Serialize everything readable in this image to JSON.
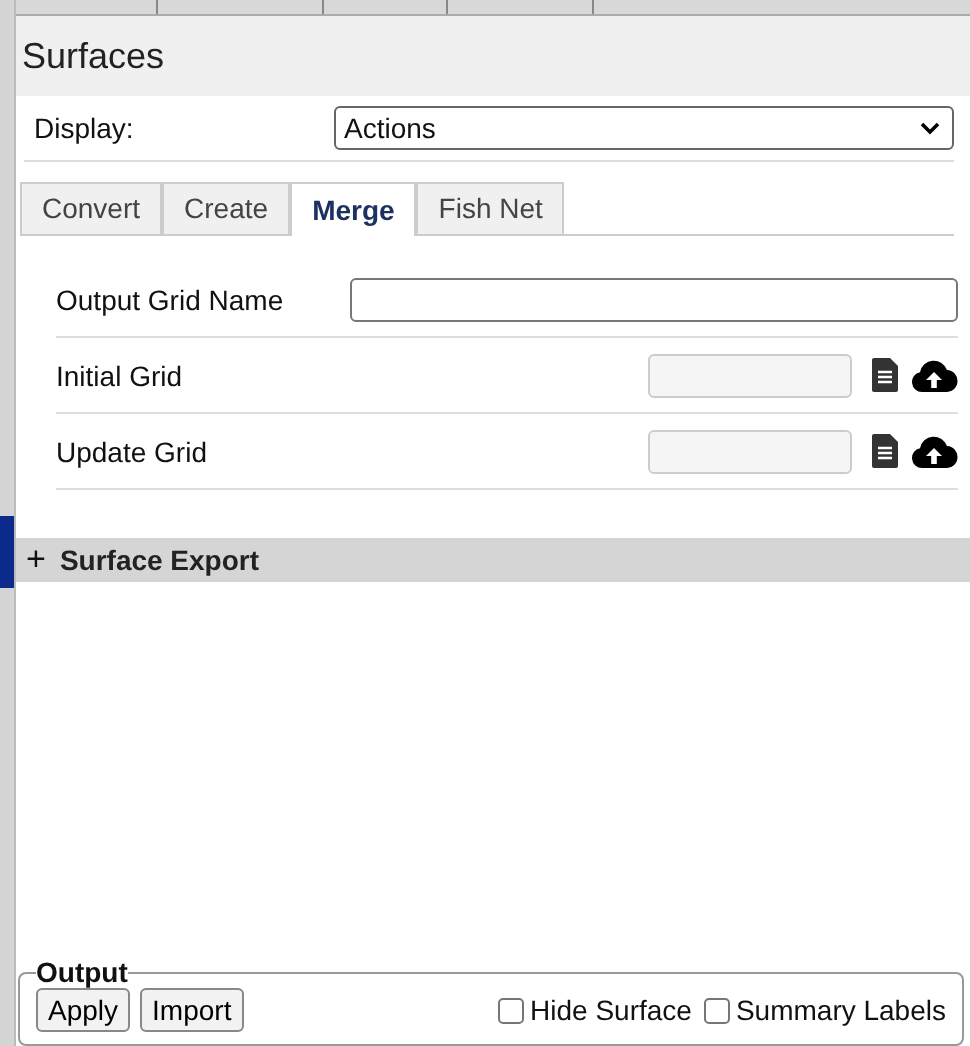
{
  "panel": {
    "title": "Surfaces"
  },
  "display": {
    "label": "Display:",
    "value": "Actions"
  },
  "tabs": [
    {
      "label": "Convert",
      "selected": false
    },
    {
      "label": "Create",
      "selected": false
    },
    {
      "label": "Merge",
      "selected": true
    },
    {
      "label": "Fish Net",
      "selected": false
    }
  ],
  "form": [
    {
      "kind": "text",
      "label": "Output Grid Name"
    },
    {
      "kind": "file",
      "label": "Initial Grid"
    },
    {
      "kind": "file",
      "label": "Update Grid"
    }
  ],
  "section": {
    "title": "Surface Export",
    "expanded": false,
    "toggle": "+"
  },
  "output": {
    "legend": "Output",
    "buttons": [
      "Apply",
      "Import"
    ],
    "options": [
      {
        "label": "Hide Surface",
        "checked": false
      },
      {
        "label": "Summary Labels",
        "checked": false
      }
    ]
  }
}
